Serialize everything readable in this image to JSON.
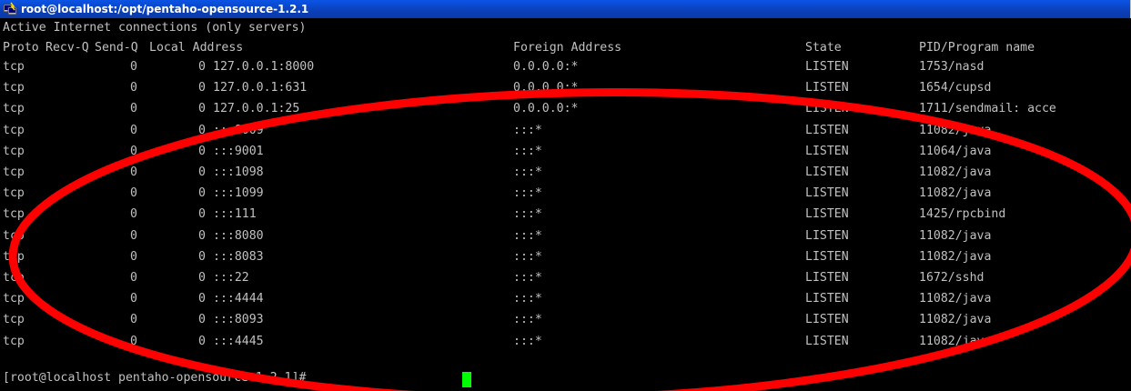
{
  "window": {
    "title": "root@localhost:/opt/pentaho-opensource-1.2.1",
    "title_icon": "putty-terminal-icon"
  },
  "terminal": {
    "heading": "Active Internet connections (only servers)",
    "columns": {
      "proto": "Proto",
      "recvq": "Recv-Q",
      "sendq": "Send-Q",
      "local": "Local Address",
      "foreign": "Foreign Address",
      "state": "State",
      "pid": "PID/Program name"
    },
    "rows": [
      {
        "proto": "tcp",
        "recvq": "0",
        "sendq": "0",
        "local": "127.0.0.1:8000",
        "foreign": "0.0.0.0:*",
        "state": "LISTEN",
        "pid": "1753/nasd"
      },
      {
        "proto": "tcp",
        "recvq": "0",
        "sendq": "0",
        "local": "127.0.0.1:631",
        "foreign": "0.0.0.0:*",
        "state": "LISTEN",
        "pid": "1654/cupsd"
      },
      {
        "proto": "tcp",
        "recvq": "0",
        "sendq": "0",
        "local": "127.0.0.1:25",
        "foreign": "0.0.0.0:*",
        "state": "LISTEN",
        "pid": "1711/sendmail: acce"
      },
      {
        "proto": "tcp",
        "recvq": "0",
        "sendq": "0",
        "local": ":::8009",
        "foreign": ":::*",
        "state": "LISTEN",
        "pid": "11082/java"
      },
      {
        "proto": "tcp",
        "recvq": "0",
        "sendq": "0",
        "local": ":::9001",
        "foreign": ":::*",
        "state": "LISTEN",
        "pid": "11064/java"
      },
      {
        "proto": "tcp",
        "recvq": "0",
        "sendq": "0",
        "local": ":::1098",
        "foreign": ":::*",
        "state": "LISTEN",
        "pid": "11082/java"
      },
      {
        "proto": "tcp",
        "recvq": "0",
        "sendq": "0",
        "local": ":::1099",
        "foreign": ":::*",
        "state": "LISTEN",
        "pid": "11082/java"
      },
      {
        "proto": "tcp",
        "recvq": "0",
        "sendq": "0",
        "local": ":::111",
        "foreign": ":::*",
        "state": "LISTEN",
        "pid": "1425/rpcbind"
      },
      {
        "proto": "tcp",
        "recvq": "0",
        "sendq": "0",
        "local": ":::8080",
        "foreign": ":::*",
        "state": "LISTEN",
        "pid": "11082/java"
      },
      {
        "proto": "tcp",
        "recvq": "0",
        "sendq": "0",
        "local": ":::8083",
        "foreign": ":::*",
        "state": "LISTEN",
        "pid": "11082/java"
      },
      {
        "proto": "tcp",
        "recvq": "0",
        "sendq": "0",
        "local": ":::22",
        "foreign": ":::*",
        "state": "LISTEN",
        "pid": "1672/sshd"
      },
      {
        "proto": "tcp",
        "recvq": "0",
        "sendq": "0",
        "local": ":::4444",
        "foreign": ":::*",
        "state": "LISTEN",
        "pid": "11082/java"
      },
      {
        "proto": "tcp",
        "recvq": "0",
        "sendq": "0",
        "local": ":::8093",
        "foreign": ":::*",
        "state": "LISTEN",
        "pid": "11082/java"
      },
      {
        "proto": "tcp",
        "recvq": "0",
        "sendq": "0",
        "local": ":::4445",
        "foreign": ":::*",
        "state": "LISTEN",
        "pid": "11082/java"
      }
    ],
    "prompt": "[root@localhost pentaho-opensource-1.2.1]# ",
    "colors": {
      "background": "#000000",
      "text": "#c0c0c0",
      "cursor": "#00ff00",
      "annotation": "#ff0000",
      "titlebar": "#0a54e6"
    }
  }
}
